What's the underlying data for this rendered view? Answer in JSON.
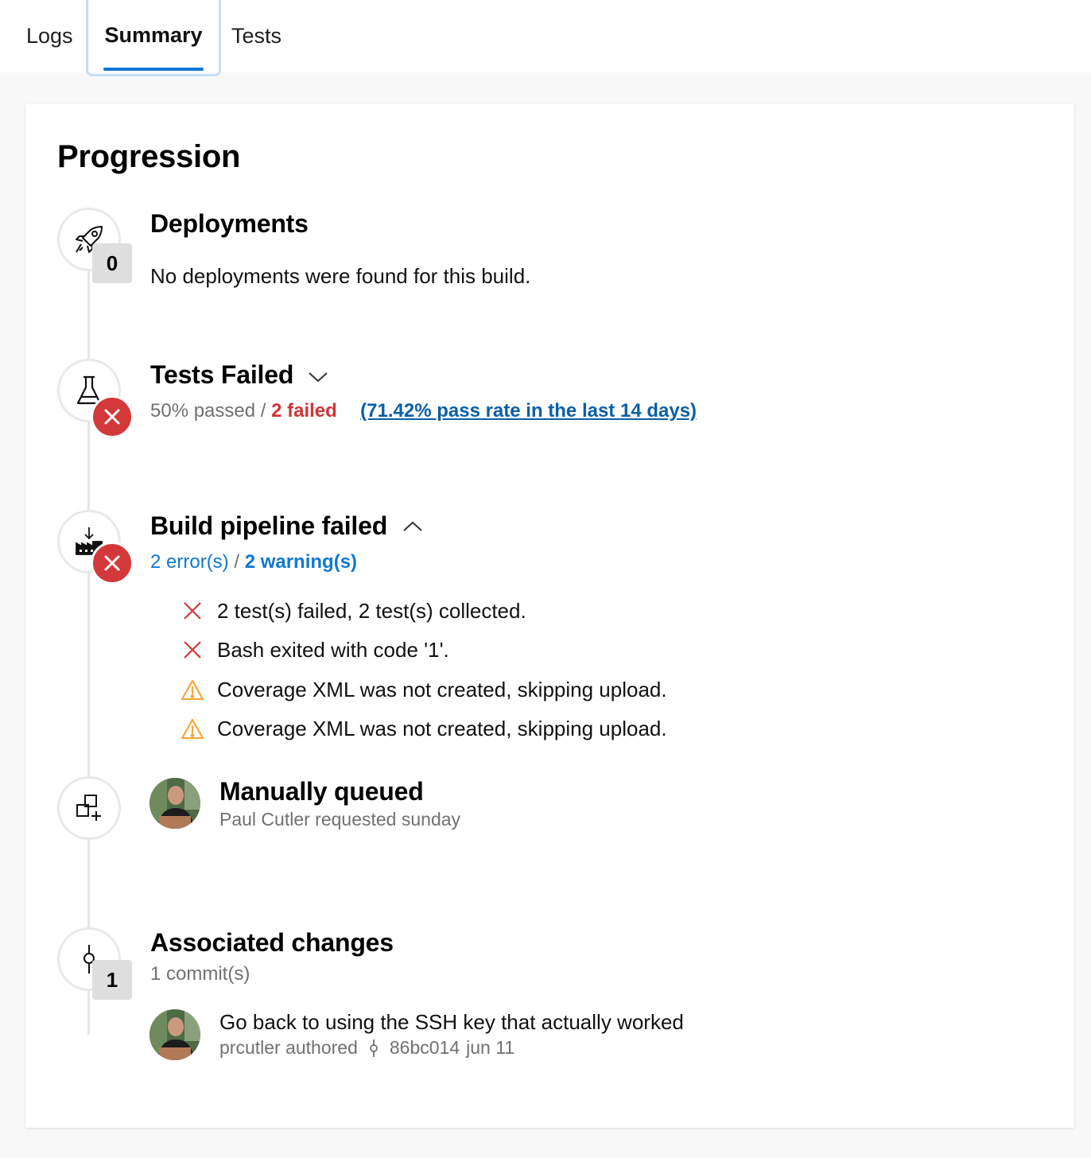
{
  "tabs": [
    {
      "label": "Logs"
    },
    {
      "label": "Summary"
    },
    {
      "label": "Tests"
    }
  ],
  "page_title": "Progression",
  "deployments": {
    "title": "Deployments",
    "count": "0",
    "message": "No deployments were found for this build."
  },
  "tests": {
    "title": "Tests Failed",
    "passed": "50% passed",
    "separator": "/",
    "failed": "2 failed",
    "pass_rate_link": "(71.42% pass rate in the last 14 days)"
  },
  "build": {
    "title": "Build pipeline failed",
    "errors": "2 error(s)",
    "separator": "/",
    "warnings": "2 warning(s)",
    "issues": [
      {
        "type": "error",
        "text": "2 test(s) failed, 2 test(s) collected."
      },
      {
        "type": "error",
        "text": "Bash exited with code '1'."
      },
      {
        "type": "warning",
        "text": "Coverage XML was not created, skipping upload."
      },
      {
        "type": "warning",
        "text": "Coverage XML was not created, skipping upload."
      }
    ]
  },
  "queued": {
    "title": "Manually queued",
    "subtitle": "Paul Cutler requested sunday"
  },
  "changes": {
    "title": "Associated changes",
    "count": "1",
    "subtitle": "1 commit(s)",
    "commit_message": "Go back to using the SSH key that actually worked",
    "author": "prcutler authored",
    "hash": "86bc014",
    "date": "jun 11"
  },
  "colors": {
    "accent": "#0f78d4",
    "error": "#d3393a",
    "warning": "#f2a73b"
  }
}
